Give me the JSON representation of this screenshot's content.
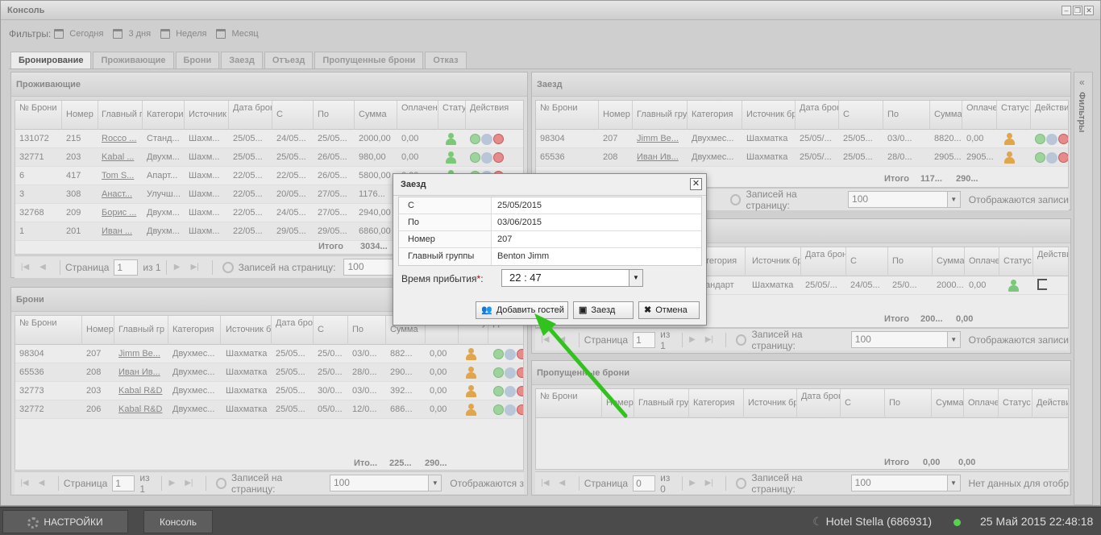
{
  "window": {
    "title": "Консоль"
  },
  "filters": {
    "label": "Фильтры:",
    "items": [
      "Сегодня",
      "3 дня",
      "Неделя",
      "Месяц"
    ]
  },
  "tabs": [
    "Бронирование",
    "Проживающие",
    "Брони",
    "Заезд",
    "Отъезд",
    "Пропущенные брони",
    "Отказ"
  ],
  "sidebar": {
    "label": "Фильтры",
    "collapse": "«"
  },
  "living": {
    "title": "Проживающие",
    "headers": [
      "№ Брони",
      "Номер",
      "Главный г",
      "Категория",
      "Источник",
      "Дата бронирования",
      "С",
      "По",
      "Сумма",
      "Оплачено",
      "Статус",
      "Действия"
    ],
    "rows": [
      [
        "131072",
        "215",
        "Rocco ...",
        "Станд...",
        "Шахм...",
        "25/05...",
        "24/05...",
        "25/05...",
        "2000,00",
        "0,00"
      ],
      [
        "32771",
        "203",
        "Kabal ...",
        "Двухм...",
        "Шахм...",
        "25/05...",
        "25/05...",
        "26/05...",
        "980,00",
        "0,00"
      ],
      [
        "6",
        "417",
        "Tom S...",
        "Апарт...",
        "Шахм...",
        "22/05...",
        "22/05...",
        "26/05...",
        "5800,00",
        "0,00"
      ],
      [
        "3",
        "308",
        "Анаст...",
        "Улучш...",
        "Шахм...",
        "22/05...",
        "20/05...",
        "27/05...",
        "1176...",
        "0,00"
      ],
      [
        "32768",
        "209",
        "Борис ...",
        "Двухм...",
        "Шахм...",
        "22/05...",
        "24/05...",
        "27/05...",
        "2940,00",
        "0,00"
      ],
      [
        "1",
        "201",
        "Иван ...",
        "Двухм...",
        "Шахм...",
        "22/05...",
        "29/05...",
        "29/05...",
        "6860,00",
        "0,00"
      ]
    ],
    "total_label": "Итого",
    "total_sum": "3034...",
    "pager": {
      "page_label": "Страница",
      "page": "1",
      "of": "из 1",
      "per_page_label": "Записей на страницу:",
      "per_page": "100"
    }
  },
  "bookings": {
    "title": "Брони",
    "headers": [
      "№ Брони",
      "Номер",
      "Главный гр",
      "Категория",
      "Источник б",
      "Дата бронирования",
      "С",
      "По",
      "Сумма",
      "Оплачено",
      "Статус",
      "Действия"
    ],
    "rows": [
      [
        "98304",
        "207",
        "Jimm Be...",
        "Двухмес...",
        "Шахматка",
        "25/05...",
        "25/0...",
        "03/0...",
        "882...",
        "0,00"
      ],
      [
        "65536",
        "208",
        "Иван Ив...",
        "Двухмес...",
        "Шахматка",
        "25/05...",
        "25/0...",
        "28/0...",
        "290...",
        "0,00"
      ],
      [
        "32773",
        "203",
        "Kabal R&D",
        "Двухмес...",
        "Шахматка",
        "25/05...",
        "30/0...",
        "03/0...",
        "392...",
        "0,00"
      ],
      [
        "32772",
        "206",
        "Kabal R&D",
        "Двухмес...",
        "Шахматка",
        "25/05...",
        "05/0...",
        "12/0...",
        "686...",
        "0,00"
      ]
    ],
    "total_label": "Ито...",
    "total_sum": "225...",
    "total_paid": "290...",
    "pager": {
      "page_label": "Страница",
      "page": "1",
      "of": "из 1",
      "per_page_label": "Записей на страницу:",
      "per_page": "100",
      "display": "Отображаются з"
    }
  },
  "checkin": {
    "title": "Заезд",
    "headers": [
      "№ Брони",
      "Номер",
      "Главный гру",
      "Категория",
      "Источник бр",
      "Дата бронирования",
      "С",
      "По",
      "Сумма",
      "Оплачено",
      "Статус",
      "Действия"
    ],
    "rows": [
      [
        "98304",
        "207",
        "Jimm Be...",
        "Двухмес...",
        "Шахматка",
        "25/05/...",
        "25/05...",
        "03/0...",
        "8820...",
        "0,00"
      ],
      [
        "65536",
        "208",
        "Иван Ив...",
        "Двухмес...",
        "Шахматка",
        "25/05/...",
        "25/05...",
        "28/0...",
        "2905...",
        "2905..."
      ]
    ],
    "total_label": "Итого",
    "total_sum": "117...",
    "total_paid": "290...",
    "pager": {
      "per_page_label": "Записей на страницу:",
      "per_page": "100",
      "display": "Отображаются записи"
    }
  },
  "checkout": {
    "headers": [
      "тегория",
      "Источник бр",
      "Дата бронирования",
      "С",
      "По",
      "Сумма",
      "Оплачено",
      "Статус",
      "Действия"
    ],
    "row": [
      "андарт",
      "Шахматка",
      "25/05/...",
      "24/05...",
      "25/0...",
      "2000...",
      "0,00"
    ],
    "total_label": "Итого",
    "total_sum": "200...",
    "total_paid": "0,00",
    "pager": {
      "page_label": "Страница",
      "page": "1",
      "of": "из 1",
      "per_page_label": "Записей на страницу:",
      "per_page": "100",
      "display": "Отображаются записи"
    }
  },
  "missed": {
    "title": "Пропущенные брони",
    "headers": [
      "№ Брони",
      "Номер",
      "Главный гру",
      "Категория",
      "Источник бр",
      "Дата бронирования",
      "С",
      "По",
      "Сумма",
      "Оплачено",
      "Статус",
      "Действия"
    ],
    "total_label": "Итого",
    "total_sum": "0,00",
    "total_paid": "0,00",
    "pager": {
      "page_label": "Страница",
      "page": "0",
      "of": "из 0",
      "per_page_label": "Записей на страницу:",
      "per_page": "100",
      "display": "Нет данных для отобр"
    }
  },
  "dialog": {
    "title": "Заезд",
    "close": "✕",
    "fields": [
      {
        "label": "С",
        "value": "25/05/2015"
      },
      {
        "label": "По",
        "value": "03/06/2015"
      },
      {
        "label": "Номер",
        "value": "207"
      },
      {
        "label": "Главный группы",
        "value": "Benton Jimm"
      }
    ],
    "arrival_label": "Время прибытия",
    "required": "*",
    "arrival_colon": ":",
    "arrival_value": "22 : 47",
    "buttons": {
      "add_guests": "Добавить гостей",
      "checkin": "Заезд",
      "cancel": "Отмена"
    }
  },
  "taskbar": {
    "settings": "НАСТРОЙКИ",
    "console": "Консоль",
    "hotel": "Hotel Stella (686931)",
    "datetime": "25 Май 2015 22:48:18"
  },
  "colors": {
    "accent_green": "#3bb02c",
    "guest_green": "#7cc87a",
    "guest_orange": "#e1a54b"
  }
}
